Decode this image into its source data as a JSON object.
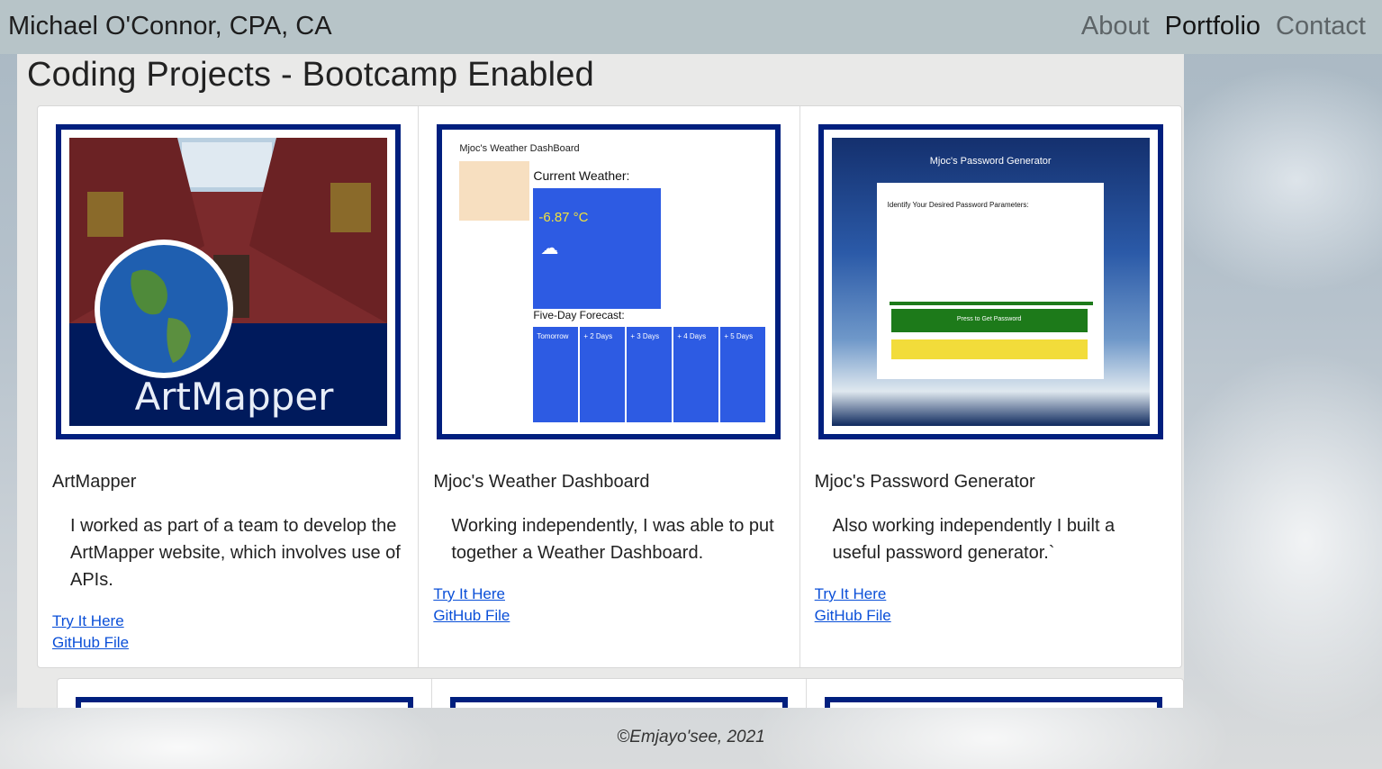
{
  "navbar": {
    "brand": "Michael O'Connor, CPA, CA",
    "links": [
      "About",
      "Portfolio",
      "Contact"
    ],
    "active": "Portfolio"
  },
  "page_title": "Coding Projects - Bootcamp Enabled",
  "cards": [
    {
      "title": "ArtMapper",
      "text": "I worked as part of a team to develop the ArtMapper website, which involves use of APIs.",
      "thumb_caption": "ArtMapper",
      "link1": "Try It Here",
      "link2": "GitHub File"
    },
    {
      "title": "Mjoc's Weather Dashboard",
      "text": "Working independently, I was able to put together a Weather Dashboard.",
      "thumb": {
        "heading": "Mjoc's Weather DashBoard",
        "current_label": "Current Weather:",
        "temp": "-6.87 °C",
        "forecast_label": "Five-Day Forecast:",
        "days": [
          "Tomorrow",
          "+ 2 Days",
          "+ 3 Days",
          "+ 4 Days",
          "+ 5 Days"
        ]
      },
      "link1": "Try It Here",
      "link2": "GitHub File"
    },
    {
      "title": "Mjoc's Password Generator",
      "text": "Also working independently I built a useful password generator.`",
      "thumb": {
        "heading": "Mjoc's Password Generator",
        "subheading": "Identify Your Desired Password Parameters:",
        "button": "Press to Get Password"
      },
      "link1": "Try It Here",
      "link2": "GitHub File"
    }
  ],
  "footer": "©Emjayo'see, 2021"
}
